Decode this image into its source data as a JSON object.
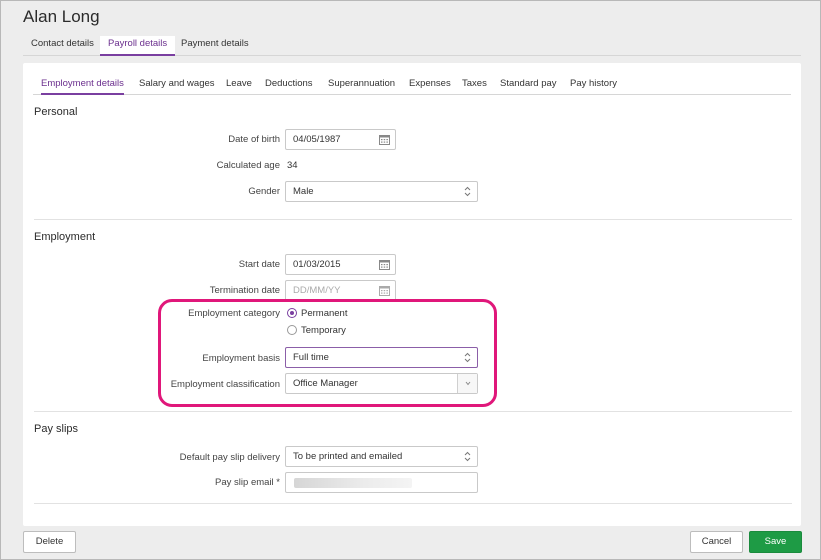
{
  "page": {
    "title": "Alan Long"
  },
  "top_tabs": [
    {
      "label": "Contact details"
    },
    {
      "label": "Payroll details",
      "active": true
    },
    {
      "label": "Payment details"
    }
  ],
  "sub_tabs": [
    {
      "label": "Employment details",
      "active": true
    },
    {
      "label": "Salary and wages"
    },
    {
      "label": "Leave"
    },
    {
      "label": "Deductions"
    },
    {
      "label": "Superannuation"
    },
    {
      "label": "Expenses"
    },
    {
      "label": "Taxes"
    },
    {
      "label": "Standard pay"
    },
    {
      "label": "Pay history"
    }
  ],
  "personal": {
    "heading": "Personal",
    "dob_label": "Date of birth",
    "dob_value": "04/05/1987",
    "age_label": "Calculated age",
    "age_value": "34",
    "gender_label": "Gender",
    "gender_value": "Male"
  },
  "employment": {
    "heading": "Employment",
    "start_label": "Start date",
    "start_value": "01/03/2015",
    "termination_label": "Termination date",
    "termination_placeholder": "DD/MM/YY",
    "category_label": "Employment category",
    "category_options": [
      "Permanent",
      "Temporary"
    ],
    "category_selected": "Permanent",
    "basis_label": "Employment basis",
    "basis_value": "Full time",
    "classification_label": "Employment classification",
    "classification_value": "Office Manager"
  },
  "pay_slips": {
    "heading": "Pay slips",
    "delivery_label": "Default pay slip delivery",
    "delivery_value": "To be printed and emailed",
    "email_label": "Pay slip email *"
  },
  "footer": {
    "delete_label": "Delete",
    "cancel_label": "Cancel",
    "save_label": "Save"
  },
  "colors": {
    "accent": "#7a3fa0",
    "highlight": "#e0177a",
    "save": "#1e9b45"
  }
}
